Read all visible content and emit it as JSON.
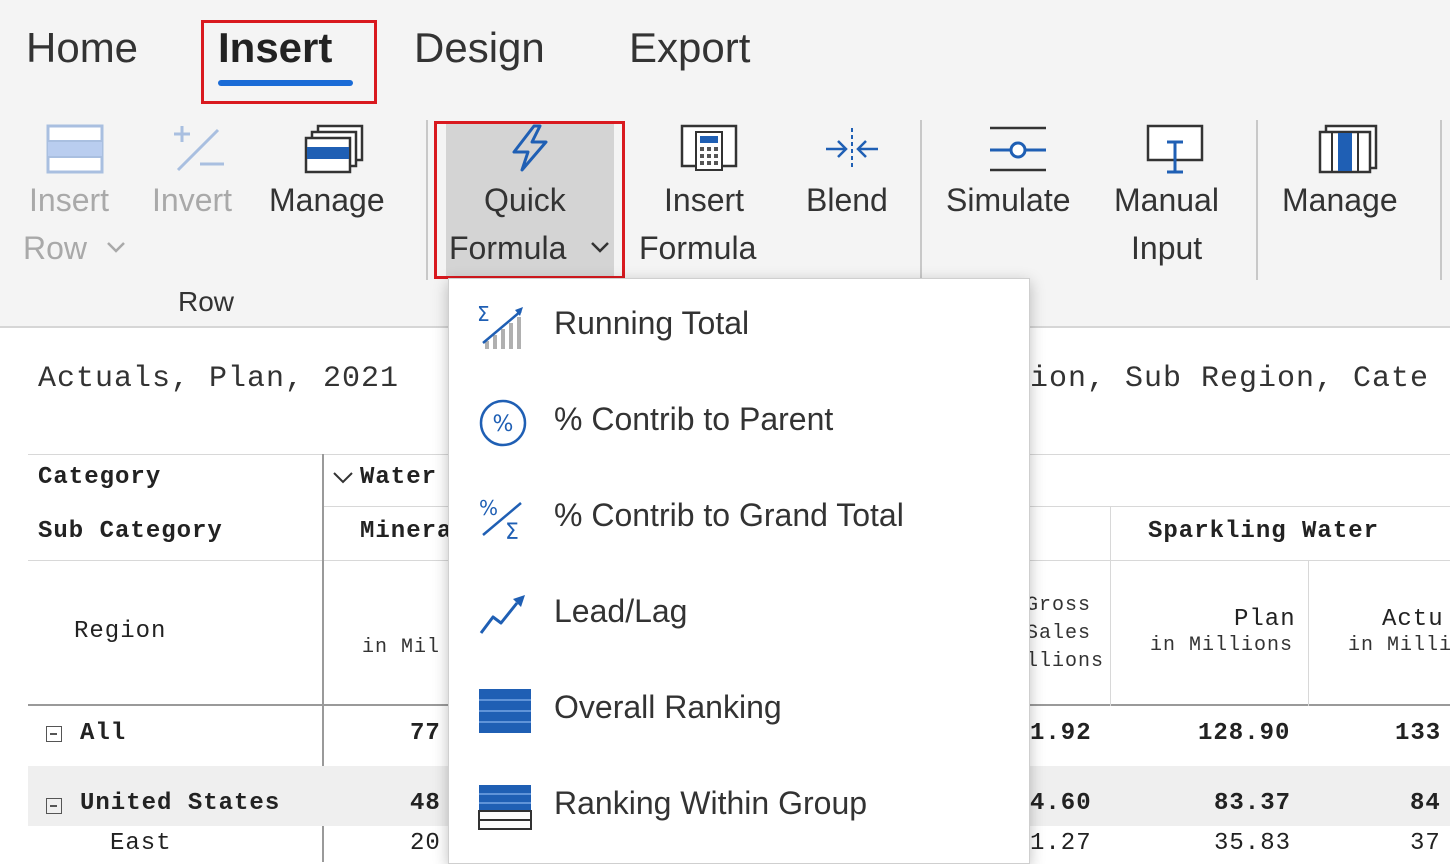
{
  "tabs": [
    "Home",
    "Insert",
    "Design",
    "Export"
  ],
  "active_tab": "Insert",
  "ribbon": {
    "insert_row": {
      "line1": "Insert",
      "line2": "Row"
    },
    "invert": "Invert",
    "manage_row": "Manage",
    "row_group_label": "Row",
    "quick_formula": {
      "line1": "Quick",
      "line2": "Formula"
    },
    "insert_formula": {
      "line1": "Insert",
      "line2": "Formula"
    },
    "blend": "Blend",
    "simulate": "Simulate",
    "manual_input": {
      "line1": "Manual",
      "line2": "Input"
    },
    "manage_right": "Manage"
  },
  "quick_formula_menu": [
    {
      "label": "Running Total",
      "icon": "running-total-icon"
    },
    {
      "label": "% Contrib to Parent",
      "icon": "percent-circle-icon"
    },
    {
      "label": "% Contrib to Grand Total",
      "icon": "percent-sigma-icon"
    },
    {
      "label": "Lead/Lag",
      "icon": "trend-arrow-icon"
    },
    {
      "label": "Overall Ranking",
      "icon": "ranking-table-icon"
    },
    {
      "label": "Ranking Within Group",
      "icon": "ranking-group-icon"
    }
  ],
  "sheet": {
    "title_left": "Actuals, Plan, 2021",
    "title_right": "ion, Sub Region, Cate",
    "row_headers": {
      "category": "Category",
      "sub_category": "Sub Category",
      "region": "Region"
    },
    "category_value": "Water",
    "sub_category_value": "Minera",
    "mineral_unit": "in Mil",
    "gross_sales": {
      "line1": "Gross",
      "line2": "Sales",
      "line3": "llions"
    },
    "sparkling_water": "Sparkling Water",
    "plan": {
      "label": "Plan",
      "unit": "in Millions"
    },
    "actual": {
      "label": "Actu",
      "unit": "in Milli"
    },
    "rows": [
      {
        "label": "All",
        "mineral": "77",
        "gross": "1.92",
        "plan": "128.90",
        "actual": "133"
      },
      {
        "label": "United States",
        "mineral": "48",
        "gross": "4.60",
        "plan": "83.37",
        "actual": "84"
      },
      {
        "label": "East",
        "mineral": "20",
        "gross": "1.27",
        "plan": "35.83",
        "actual": "37"
      }
    ]
  },
  "colors": {
    "accent": "#1a6bd6",
    "highlight_box": "#d9191f",
    "icon_blue": "#1f5fb4"
  }
}
